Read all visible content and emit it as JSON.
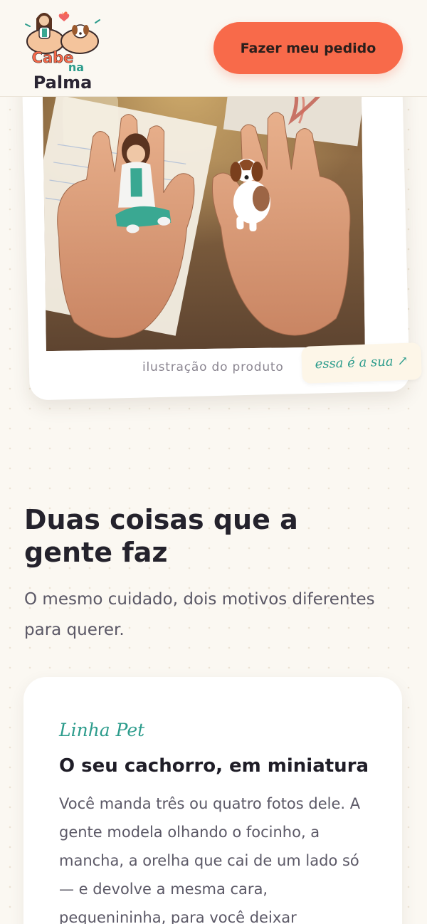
{
  "header": {
    "logo_text": [
      "Cabe",
      "na",
      "Palma"
    ],
    "cta_label": "Fazer meu pedido"
  },
  "hero": {
    "caption": "ilustração do produto",
    "tag": "essa é a sua ↗"
  },
  "section": {
    "title": "Duas coisas que a gente faz",
    "subtitle": "O mesmo cuidado, dois motivos diferentes para querer."
  },
  "pet_card": {
    "kicker": "Linha Pet",
    "title": "O seu cachorro, em miniatura",
    "text": "Você manda três ou quatro fotos dele. A gente modela olhando o focinho, a mancha, a orelha que cai de um lado só — e devolve a mesma cara, pequenininha, para você deixar"
  },
  "colors": {
    "accent": "#f86a4a",
    "teal": "#2c9c8c",
    "background": "#fbf8f2"
  }
}
